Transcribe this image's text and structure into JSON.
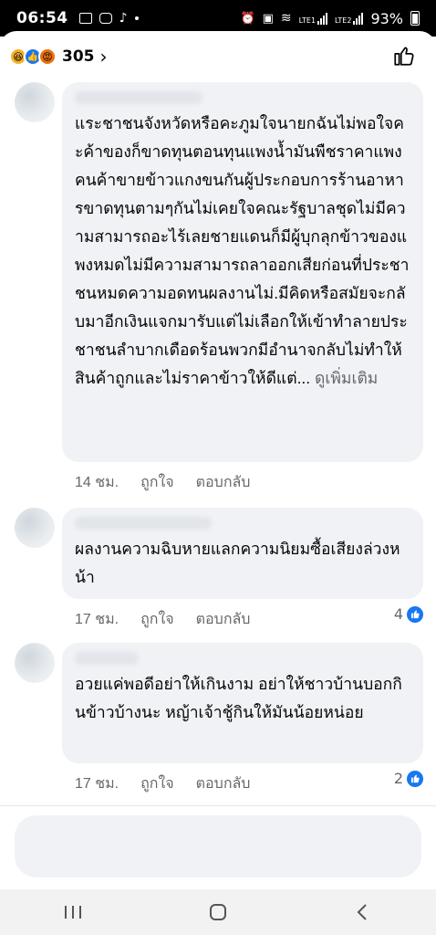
{
  "status_bar": {
    "time": "06:54",
    "battery": "93%",
    "sim1": "LTE1",
    "sim2": "LTE2"
  },
  "reactions": {
    "count": "305",
    "types": [
      "haha-icon",
      "like-icon",
      "angry-icon"
    ]
  },
  "comments": [
    {
      "text": "แระชาชนจังหวัดหรือคะภูมใจนายกฉันไม่พอใจคะค้าของก็ขาดทุนตอนทุนแพงน้ำมันพืชราคาแพงคนค้าขายข้าวแกงขนกันผู้ประกอบการร้านอาหารขาดทุนตามๆกันไม่เคยใจคณะรัฐบาลชุดไม่มีความสามารถอะไร้เลยชายแดนก็มีผู้บุกลุกข้าวของแพงหมดไม่มีความสามารถลาออกเสียก่อนที่ประชาชนหมดความอดทนผลงานไม่.มีคิดหรือสมัยจะกลับมาอีกเงินแจกมารับแต่ไม่เลือกให้เข้าทำลายประชาชนลำบากเดือดร้อนพวกมีอำนาจกลับไม่ทำให้สินค้าถูกและไม่ราคาข้าวให้ดีแต่...",
      "see_more": "ดูเพิ่มเติม",
      "time": "14 ชม.",
      "like_label": "ถูกใจ",
      "reply_label": "ตอบกลับ",
      "likes": ""
    },
    {
      "text": "ผลงานความฉิบหายแลกความนิยมซื้อเสียงล่วงหน้า",
      "time": "17 ชม.",
      "like_label": "ถูกใจ",
      "reply_label": "ตอบกลับ",
      "likes": "4"
    },
    {
      "text": "อวยแค่พอดีอย่าให้เกินงาม  อย่าให้ชาวบ้านบอกกินข้าวบ้างนะ  หญ้าเจ้าชู้กินให้มันน้อยหน่อย",
      "time": "17 ชม.",
      "like_label": "ถูกใจ",
      "reply_label": "ตอบกลับ",
      "likes": "2"
    }
  ],
  "colors": {
    "bubble": "#f0f2f5",
    "meta": "#65676b",
    "like_blue": "#1877f2"
  }
}
